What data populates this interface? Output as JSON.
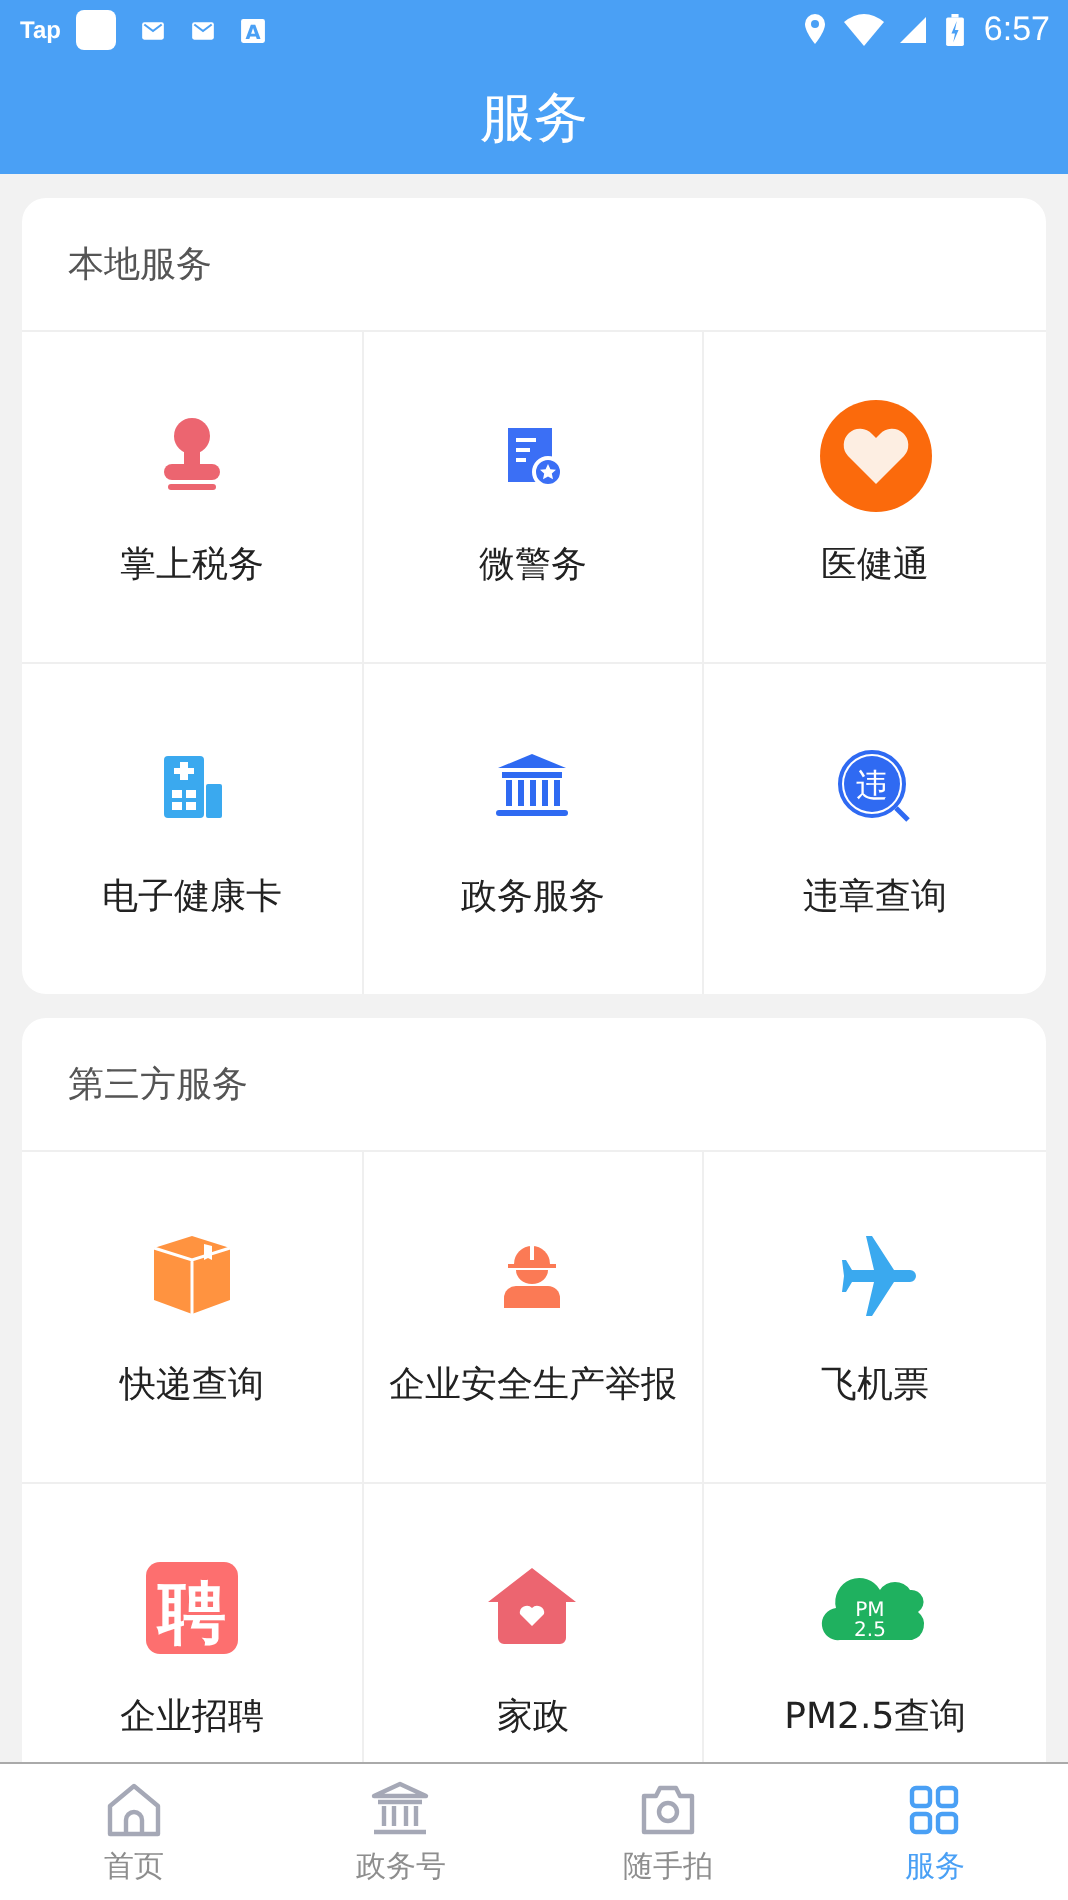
{
  "status_bar": {
    "app_label": "Tap",
    "notification_letter": "A",
    "time": "6:57"
  },
  "header": {
    "title": "服务"
  },
  "sections": [
    {
      "title": "本地服务",
      "items": [
        {
          "label": "掌上税务",
          "kind": "stamp"
        },
        {
          "label": "微警务",
          "kind": "document"
        },
        {
          "label": "医健通",
          "kind": "heart"
        },
        {
          "label": "电子健康卡",
          "kind": "hospital"
        },
        {
          "label": "政务服务",
          "kind": "bank"
        },
        {
          "label": "违章查询",
          "kind": "lens",
          "icon_text": "违"
        }
      ]
    },
    {
      "title": "第三方服务",
      "items": [
        {
          "label": "快递查询",
          "kind": "box"
        },
        {
          "label": "企业安全生产举报",
          "kind": "worker"
        },
        {
          "label": "飞机票",
          "kind": "plane"
        },
        {
          "label": "企业招聘",
          "kind": "tile",
          "icon_text": "聘"
        },
        {
          "label": "家政",
          "kind": "house"
        },
        {
          "label": "PM2.5查询",
          "kind": "cloud",
          "icon_text": "PM 2.5"
        }
      ]
    }
  ],
  "tab_bar": [
    {
      "label": "首页",
      "kind": "home",
      "selected": false
    },
    {
      "label": "政务号",
      "kind": "bank",
      "selected": false
    },
    {
      "label": "随手拍",
      "kind": "camera",
      "selected": false
    },
    {
      "label": "服务",
      "kind": "grid",
      "selected": true
    }
  ]
}
